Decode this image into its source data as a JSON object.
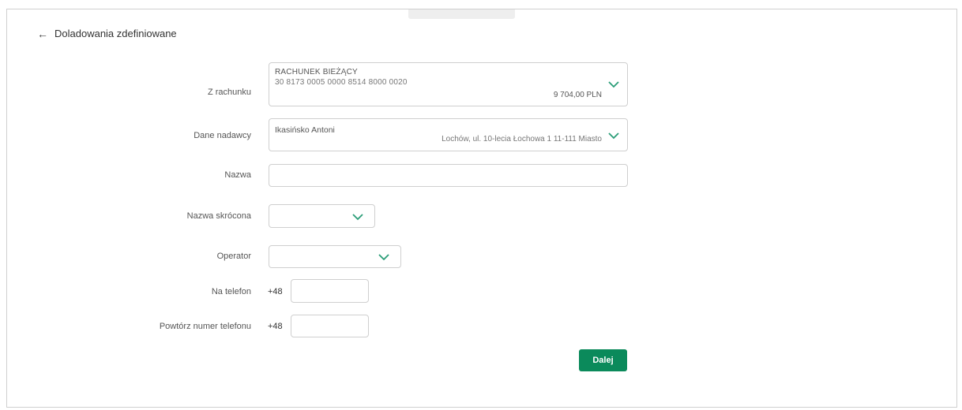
{
  "header": {
    "back_icon": "←",
    "title": "Doladowania zdefiniowane"
  },
  "form": {
    "from_account": {
      "label": "Z rachunku",
      "account_name": "RACHUNEK BIEŻĄCY",
      "account_number": "30 8173 0005 0000 8514 8000 0020",
      "balance": "9 704,00 PLN"
    },
    "sender": {
      "label": "Dane nadawcy",
      "name": "Ikasińsko Antoni",
      "address": "Lochów, ul. 10-lecia Łochowa 1 11-111 Miasto"
    },
    "name": {
      "label": "Nazwa",
      "value": ""
    },
    "short_name": {
      "label": "Nazwa skrócona",
      "value": ""
    },
    "operator": {
      "label": "Operator",
      "value": ""
    },
    "phone": {
      "label": "Na telefon",
      "prefix": "+48",
      "value": ""
    },
    "phone_repeat": {
      "label": "Powtórz numer telefonu",
      "prefix": "+48",
      "value": ""
    },
    "next_button": "Dalej"
  },
  "colors": {
    "accent": "#0b8a5b",
    "chevron": "#2a9d77"
  },
  "icons": {
    "back": "arrow-left-icon",
    "dropdown": "chevron-down-icon"
  }
}
